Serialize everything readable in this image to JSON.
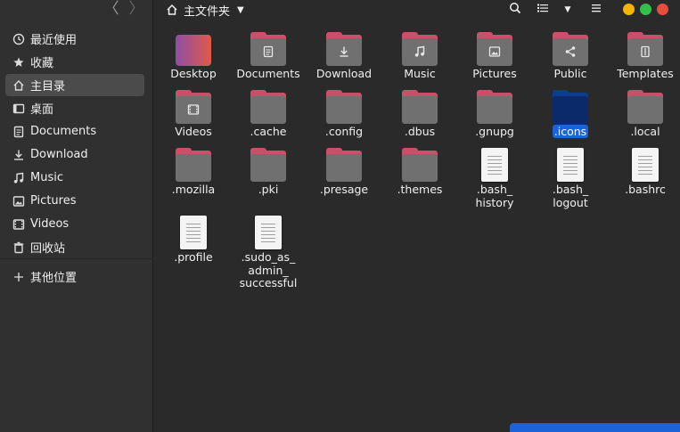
{
  "window": {
    "title": "主文件夹",
    "buttons": {
      "minimize": "#f6b500",
      "maximize": "#30c04b",
      "close": "#e74c3c"
    }
  },
  "nav": {
    "back": "〈",
    "forward": "〉"
  },
  "sidebar": {
    "items": [
      {
        "label": "最近使用",
        "icon": "clock-icon"
      },
      {
        "label": "收藏",
        "icon": "star-icon"
      },
      {
        "label": "主目录",
        "icon": "home-icon",
        "selected": true
      },
      {
        "label": "桌面",
        "icon": "desktop-icon"
      },
      {
        "label": "Documents",
        "icon": "document-icon"
      },
      {
        "label": "Download",
        "icon": "download-icon"
      },
      {
        "label": "Music",
        "icon": "music-icon"
      },
      {
        "label": "Pictures",
        "icon": "picture-icon"
      },
      {
        "label": "Videos",
        "icon": "video-icon"
      },
      {
        "label": "回收站",
        "icon": "trash-icon"
      },
      {
        "label": "其他位置",
        "icon": "plus-icon"
      }
    ]
  },
  "files": [
    {
      "name": "Desktop",
      "type": "desktop-folder"
    },
    {
      "name": "Documents",
      "type": "folder",
      "glyph": "document"
    },
    {
      "name": "Download",
      "type": "folder",
      "glyph": "download"
    },
    {
      "name": "Music",
      "type": "folder",
      "glyph": "music"
    },
    {
      "name": "Pictures",
      "type": "folder",
      "glyph": "picture"
    },
    {
      "name": "Public",
      "type": "folder",
      "glyph": "share"
    },
    {
      "name": "Templates",
      "type": "folder",
      "glyph": "template"
    },
    {
      "name": "Videos",
      "type": "folder",
      "glyph": "video"
    },
    {
      "name": ".cache",
      "type": "folder"
    },
    {
      "name": ".config",
      "type": "folder"
    },
    {
      "name": ".dbus",
      "type": "folder"
    },
    {
      "name": ".gnupg",
      "type": "folder"
    },
    {
      "name": ".icons",
      "type": "folder",
      "selected": true
    },
    {
      "name": ".local",
      "type": "folder"
    },
    {
      "name": ".mozilla",
      "type": "folder"
    },
    {
      "name": ".pki",
      "type": "folder"
    },
    {
      "name": ".presage",
      "type": "folder"
    },
    {
      "name": ".themes",
      "type": "folder"
    },
    {
      "name": ".bash_ history",
      "type": "file"
    },
    {
      "name": ".bash_ logout",
      "type": "file"
    },
    {
      "name": ".bashrc",
      "type": "file"
    },
    {
      "name": ".profile",
      "type": "file"
    },
    {
      "name": ".sudo_as_ admin_ successful",
      "type": "file"
    }
  ],
  "colors": {
    "folder_accent": "#c8506a",
    "folder_body": "#707070",
    "selection": "#1d63d8",
    "desktop_gradient": [
      "#8e4ea3",
      "#e0594a"
    ]
  }
}
